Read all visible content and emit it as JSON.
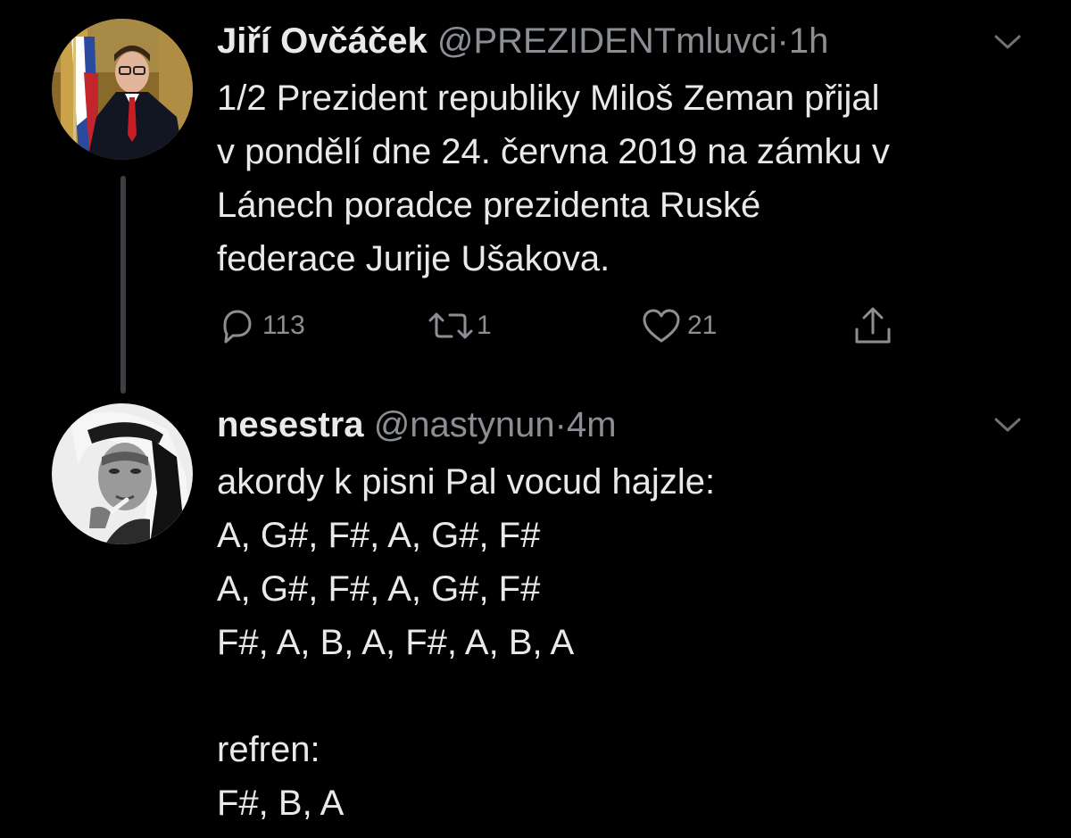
{
  "tweets": [
    {
      "name": "Jiří Ovčáček",
      "handle": "@PREZIDENTmluvci",
      "separator": "·",
      "time": "1h",
      "lines": [
        "1/2 Prezident republiky Miloš Zeman přijal",
        "v pondělí dne 24. června 2019 na zámku v",
        "Lánech poradce prezidenta Ruské",
        "federace Jurije Ušakova."
      ],
      "actions": {
        "reply_count": "113",
        "retweet_count": "1",
        "like_count": "21"
      },
      "avatar_icon": "person-avatar-icon"
    },
    {
      "name": "nesestra",
      "handle": "@nastynun",
      "separator": "·",
      "time": "4m",
      "lines": [
        "akordy k pisni Pal vocud hajzle:",
        "A, G#, F#, A, G#, F#",
        "A, G#, F#, A, G#, F#",
        "F#, A, B, A, F#, A, B, A",
        "",
        "refren:",
        "F#, B, A"
      ],
      "avatar_icon": "person-avatar-icon"
    }
  ],
  "colors": {
    "background": "#000000",
    "text": "#e7e9ea",
    "secondary": "#8b8f93",
    "thread_line": "#3c3f43"
  }
}
